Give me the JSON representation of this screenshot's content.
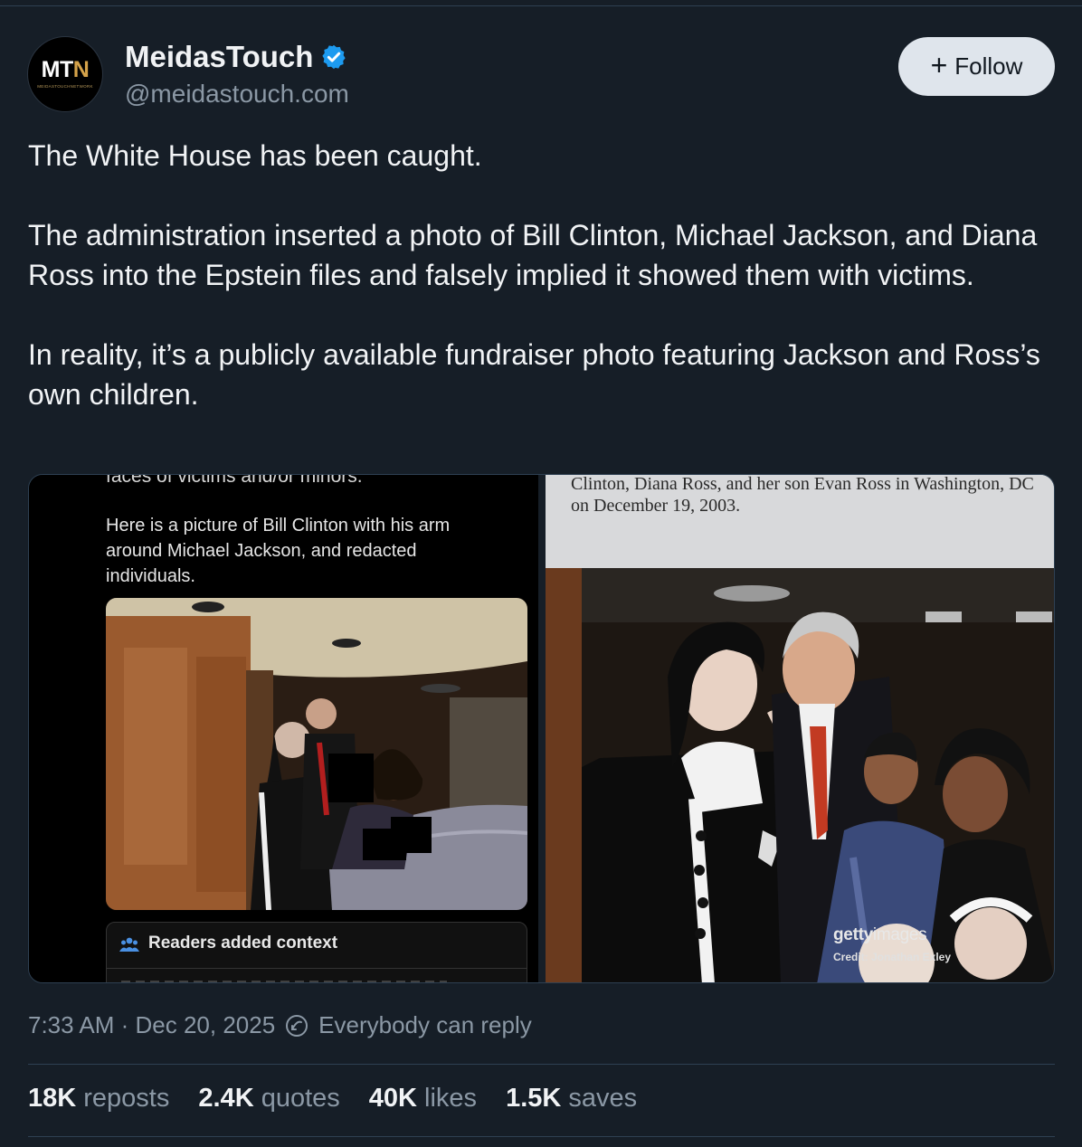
{
  "author": {
    "avatar_text": "MTN",
    "avatar_subtext": "MEIDASTOUCHNETWORK",
    "display_name": "MeidasTouch",
    "handle": "@meidastouch.com",
    "verified": true
  },
  "follow_button": {
    "label": "Follow",
    "icon": "plus-icon"
  },
  "post": {
    "paragraphs": [
      "The White House has been caught.",
      "The administration inserted a photo of Bill Clinton, Michael Jackson, and Diana Ross into the Epstein files and falsely implied it showed them with victims.",
      "In reality, it’s a publicly available fundraiser photo featuring Jackson and Ross’s own children."
    ]
  },
  "media": {
    "left": {
      "cut_text": "faces of victims and/or minors.",
      "caption": "Here is a picture of Bill Clinton with his arm around Michael Jackson, and redacted individuals.",
      "context_label": "Readers added context"
    },
    "right": {
      "caption": "Clinton, Diana Ross, and her son Evan Ross in Washington, DC on December 19, 2003.",
      "watermark_bold": "getty",
      "watermark_light": "images",
      "credit": "Credit: Jonathan Exley"
    }
  },
  "meta": {
    "timestamp": "7:33 AM · Dec 20, 2025",
    "reply_setting": "Everybody can reply"
  },
  "stats": [
    {
      "value": "18K",
      "label": "reposts"
    },
    {
      "value": "2.4K",
      "label": "quotes"
    },
    {
      "value": "40K",
      "label": "likes"
    },
    {
      "value": "1.5K",
      "label": "saves"
    }
  ],
  "colors": {
    "background": "#161e27",
    "text_primary": "#f1f3f5",
    "text_secondary": "#8b98a5",
    "verified": "#1d9bf0",
    "follow_bg": "#dfe5ec"
  }
}
